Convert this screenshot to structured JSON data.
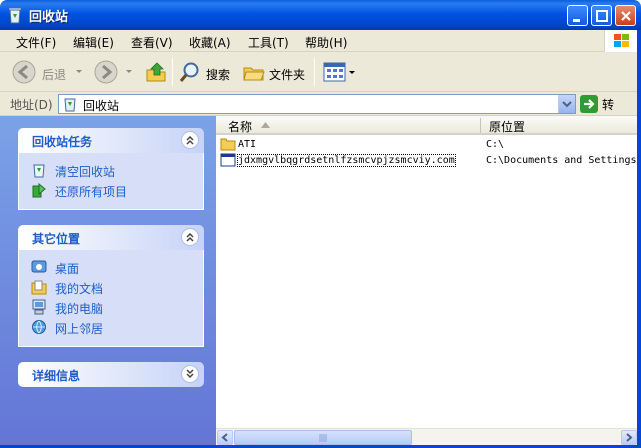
{
  "window": {
    "title": "回收站"
  },
  "menu": [
    "文件(F)",
    "编辑(E)",
    "查看(V)",
    "收藏(A)",
    "工具(T)",
    "帮助(H)"
  ],
  "toolbar": {
    "back": "后退",
    "search": "搜索",
    "folders": "文件夹"
  },
  "address": {
    "label": "地址(D)",
    "value": "回收站",
    "go": "转到"
  },
  "tasks_panel": {
    "title": "回收站任务",
    "items": [
      "清空回收站",
      "还原所有项目"
    ]
  },
  "places_panel": {
    "title": "其它位置",
    "items": [
      "桌面",
      "我的文档",
      "我的电脑",
      "网上邻居"
    ]
  },
  "details_panel": {
    "title": "详细信息"
  },
  "columns": {
    "name": "名称",
    "original_location": "原位置"
  },
  "files": [
    {
      "name": "ATI",
      "original_location": "C:\\"
    },
    {
      "name": "jdxmgvlbqgrdsetnlfzsmcvpjzsmcviy.com",
      "original_location": "C:\\Documents and Settings"
    }
  ],
  "colors": {
    "title_blue": "#0054e3",
    "task_pane": "#7ba2e7",
    "link_blue": "#215dc6"
  }
}
